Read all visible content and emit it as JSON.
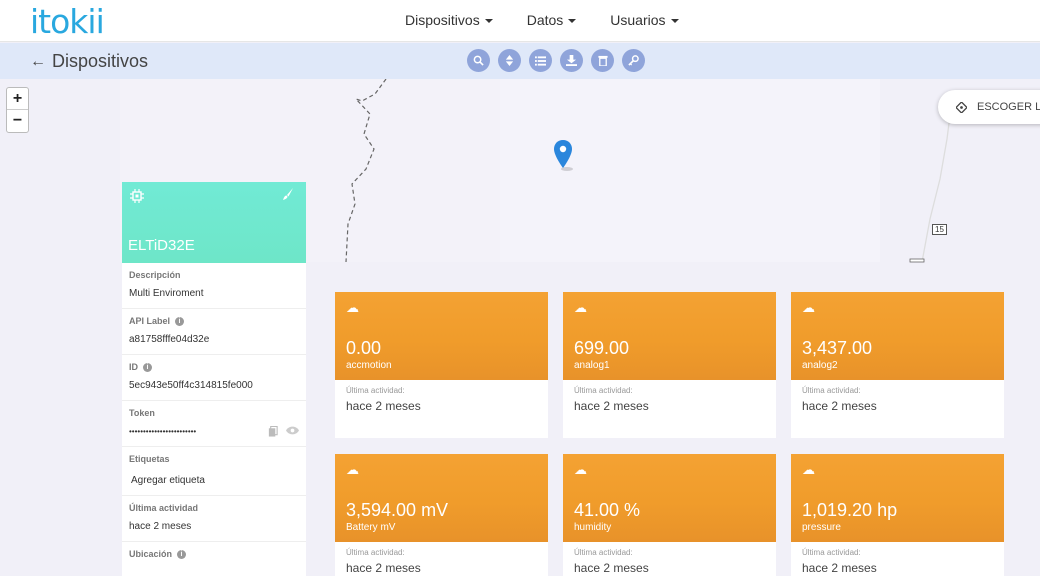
{
  "brand": {
    "logo_text": "itokii",
    "accent": "#29a8df"
  },
  "nav": {
    "items": [
      {
        "label": "Dispositivos"
      },
      {
        "label": "Datos"
      },
      {
        "label": "Usuarios"
      }
    ]
  },
  "subheader": {
    "title": "Dispositivos",
    "tools": [
      {
        "icon": "search-icon"
      },
      {
        "icon": "sort-icon"
      },
      {
        "icon": "list-icon"
      },
      {
        "icon": "download-icon"
      },
      {
        "icon": "trash-icon"
      },
      {
        "icon": "key-icon"
      }
    ]
  },
  "map": {
    "zoom_in": "+",
    "zoom_out": "−",
    "choose_location": "ESCOGER LO",
    "route_label": "15"
  },
  "device": {
    "name": "ELTiD32E",
    "header_color": "#6ee6c8",
    "fields": [
      {
        "label": "Descripción",
        "value": "Multi Enviroment"
      },
      {
        "label": "API Label",
        "value": "a81758fffe04d32e"
      },
      {
        "label": "ID",
        "value": "5ec943e50ff4c314815fe000"
      },
      {
        "label": "Token",
        "value": "••••••••••••••••••••••••"
      },
      {
        "label": "Etiquetas",
        "value": "Agregar etiqueta"
      },
      {
        "label": "Última actividad",
        "value": "hace 2 meses"
      },
      {
        "label": "Ubicación"
      }
    ]
  },
  "variables": {
    "color": "#f09c2b",
    "activity_label": "Última actividad:",
    "cards": [
      {
        "value": "0.00",
        "label": "accmotion",
        "activity": "hace 2 meses"
      },
      {
        "value": "699.00",
        "label": "analog1",
        "activity": "hace 2 meses"
      },
      {
        "value": "3,437.00",
        "label": "analog2",
        "activity": "hace 2 meses"
      },
      {
        "value": "3,594.00 mV",
        "label": "Battery mV",
        "activity": "hace 2 meses"
      },
      {
        "value": "41.00 %",
        "label": "humidity",
        "activity": "hace 2 meses"
      },
      {
        "value": "1,019.20 hp",
        "label": "pressure",
        "activity": "hace 2 meses"
      }
    ]
  }
}
